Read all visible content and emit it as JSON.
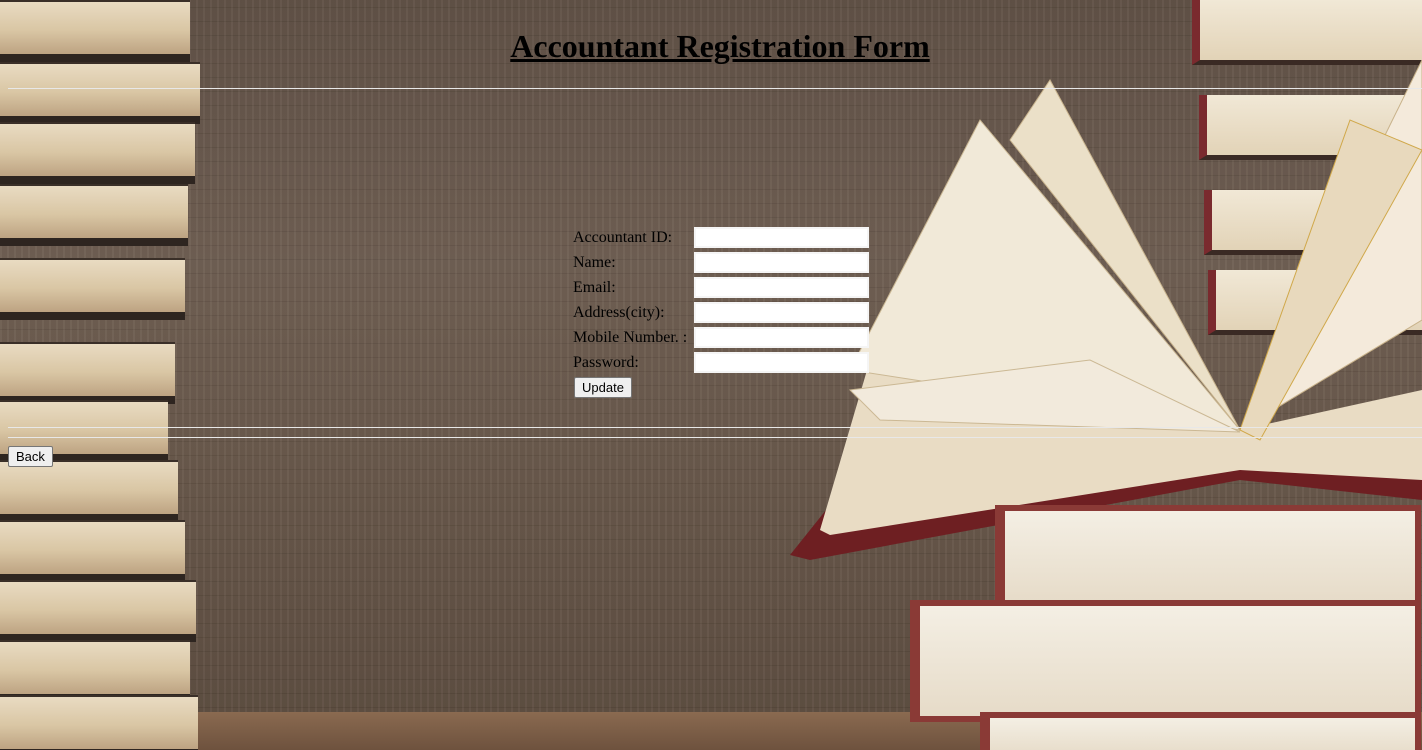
{
  "page": {
    "title": "Accountant Registration Form"
  },
  "form": {
    "fields": [
      {
        "label": "Accountant ID:",
        "value": "",
        "placeholder": ""
      },
      {
        "label": "Name:",
        "value": "",
        "placeholder": ""
      },
      {
        "label": "Email:",
        "value": "",
        "placeholder": ""
      },
      {
        "label": "Address(city):",
        "value": "",
        "placeholder": ""
      },
      {
        "label": "Mobile Number. :",
        "value": "",
        "placeholder": ""
      },
      {
        "label": "Password:",
        "value": "",
        "placeholder": ""
      }
    ],
    "update_label": "Update"
  },
  "nav": {
    "back_label": "Back"
  }
}
